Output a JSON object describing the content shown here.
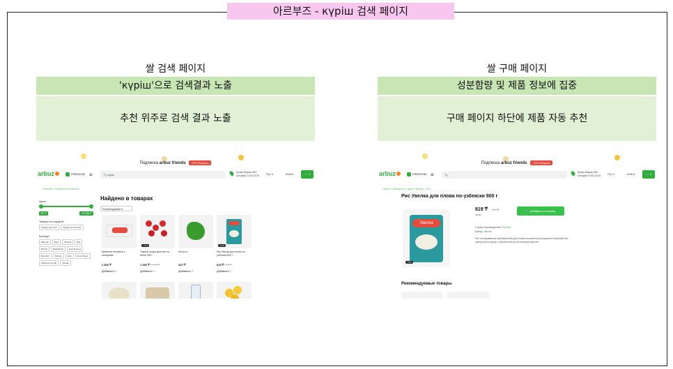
{
  "main_title": "아르부즈 - күріш 검색 페이지",
  "left": {
    "section_title": "쌀 검색 페이지",
    "highlight": "'күріш'으로 검색결과 노출",
    "note": "추천 위주로 검색 결과 노출"
  },
  "right": {
    "section_title": "쌀 구매 페이지",
    "highlight": "성분함량 및 제품 정보에 집중",
    "note": "구매 페이지 하단에 제품 자동 추천"
  },
  "site": {
    "promo_text": "Подписка",
    "promo_brand": "arbuz friends",
    "promo_badge": "10% бонусов",
    "logo": "arbuz",
    "freedom": "FREEDOM",
    "address_line1": "Бухар-Жырау 56/1",
    "address_line2": "Сегодня 21:00-22:00",
    "lang": "Рус ∨",
    "login": "Войти",
    "cart": "0"
  },
  "search_page": {
    "query": "күріш",
    "breadcrumb": "Главная / Результаты поиска",
    "heading": "Найдено в товарах",
    "sort": "Рекомендуемые",
    "price_label": "Цена",
    "price_min": "57 ₸",
    "price_max": "12 000 ₸",
    "discount_label": "Товары со скидкой",
    "discount_chips": [
      "Скидки для всех",
      "Скидки для Friends"
    ],
    "brands_label": "Бренды",
    "brand_chips": [
      "Basmati",
      "Baro",
      "Akmola",
      "Bile",
      "Bonsili",
      "Dastarkhan",
      "Eco Farmers",
      "EcoFarm",
      "Eclipse",
      "Elve",
      "Fleur Alpine",
      "Gastronomy Lab",
      "Garden"
    ],
    "products": [
      {
        "name": "Креветки тигровые в панировке",
        "price": "2 830 ₸",
        "old": "",
        "tag": "",
        "add": "Добавить +"
      },
      {
        "name": "Томаты черри красные на ветке 250 г",
        "price": "1 450 ₸",
        "old": "1 990 ₸",
        "tag": "-27%",
        "add": "Добавить +"
      },
      {
        "name": "Кинза кг",
        "price": "322 ₸",
        "old": "",
        "tag": "",
        "add": "Добавить +"
      },
      {
        "name": "Рис Увелка для плова по-узбекски 800 г",
        "price": "819 ₸",
        "old": "900 ₸",
        "tag": "-10%",
        "add": "Добавить +"
      }
    ]
  },
  "buy_page": {
    "breadcrumb": "Крупы, макароны, мука / Крупы / Рис",
    "title": "Рис Увелка для плова по-узбекски 800 г",
    "price": "819 ₸",
    "old_price": "910 ₸",
    "unit": "за шт",
    "buy_button": "Добавить в корзину",
    "country_label": "Страна производитель:",
    "country": "Россия",
    "brand_label": "Бренд:",
    "brand": "Увелка",
    "description": "Рис шлифованный пропаренный для плова получается в результате переработки зерна риса в крупу с обработкой растительным маслом.",
    "pack_brand": "Увелка",
    "discount_tag": "-10%",
    "recommended": "Рекомендуемые товары"
  },
  "colors": {
    "title_bg": "#f7c7ef",
    "bar_green": "#c8e6b4",
    "box_green": "#e2f1d6",
    "brand_green": "#2fae3c"
  }
}
